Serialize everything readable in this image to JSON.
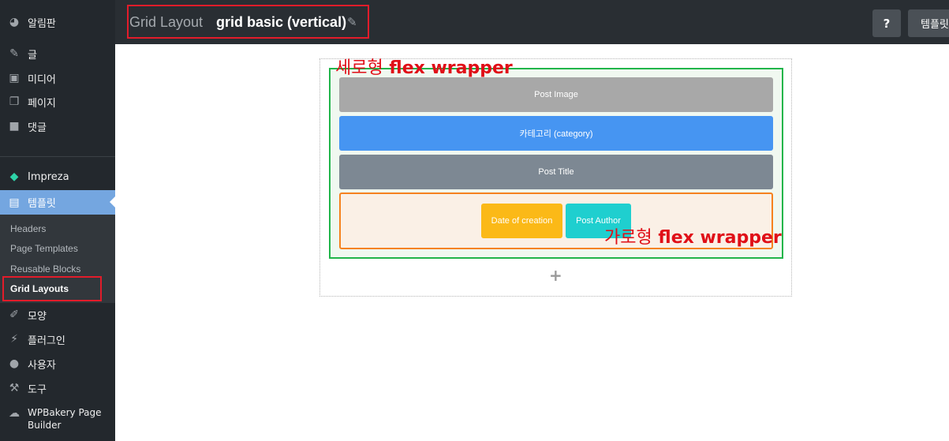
{
  "sidebar": {
    "dashboard": "알림판",
    "posts": "글",
    "media": "미디어",
    "pages": "페이지",
    "comments": "댓글",
    "impreza": "Impreza",
    "templates": "템플릿",
    "submenu": [
      "Headers",
      "Page Templates",
      "Reusable Blocks",
      "Grid Layouts"
    ],
    "appearance": "모양",
    "plugins": "플러그인",
    "users": "사용자",
    "tools": "도구",
    "wpbakery_line1": "WPBakery Page",
    "wpbakery_line2": "Builder"
  },
  "header": {
    "label": "Grid Layout",
    "name": "grid basic (vertical)",
    "help": "?",
    "templates_btn": "템플릿"
  },
  "canvas": {
    "post_image": "Post Image",
    "category": "카테고리 (category)",
    "post_title": "Post Title",
    "date": "Date of creation",
    "author": "Post Author",
    "add": "+"
  },
  "annotations": {
    "vertical_kr": "세로형",
    "vertical_en": "flex wrapper",
    "horizontal_kr": "가로형",
    "horizontal_en": "flex wrapper"
  },
  "colors": {
    "highlight_red": "#e21c2a",
    "vertical_wrapper": "#21b54a",
    "horizontal_wrapper": "#f5821f",
    "category_block": "#4695f2",
    "date_block": "#fbb917",
    "author_block": "#1fcfcf"
  },
  "icons": [
    "dashboard-icon",
    "pin-icon",
    "media-icon",
    "pages-icon",
    "comment-icon",
    "diamond-icon",
    "template-icon",
    "brush-icon",
    "plug-icon",
    "user-icon",
    "wrench-icon",
    "cloud-icon",
    "pencil-icon"
  ]
}
